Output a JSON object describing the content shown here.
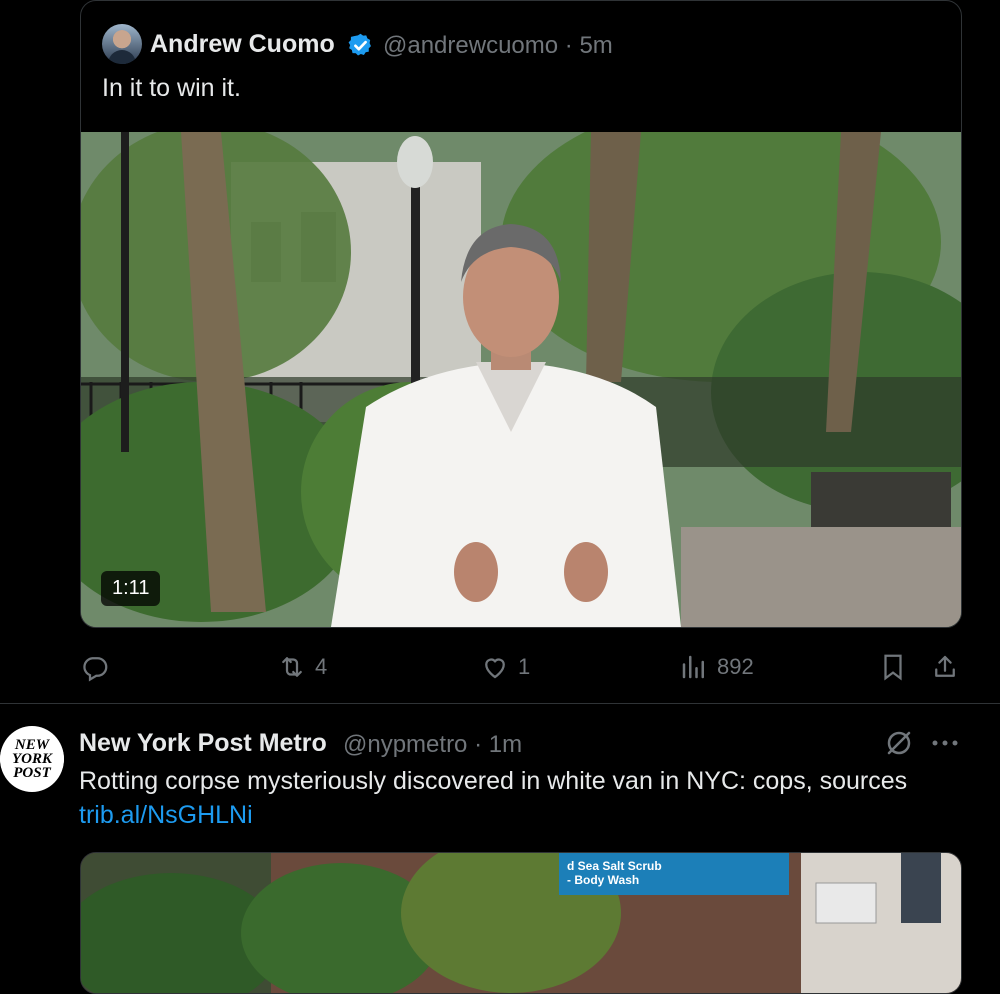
{
  "quoted_tweet": {
    "author_name": "Andrew Cuomo",
    "handle_time": "@andrewcuomo · 5m",
    "text": "In it to win it.",
    "video_duration": "1:11"
  },
  "actions": {
    "reply_count": "",
    "retweet_count": "4",
    "like_count": "1",
    "views_count": "892"
  },
  "post": {
    "author_name": "New York Post Metro",
    "handle_time": "@nypmetro · 1m",
    "text": "Rotting corpse mysteriously discovered in white van in NYC: cops, sources",
    "link": "trib.al/NsGHLNi",
    "avatar_logo_text": "NEW YORK POST",
    "media_sign_text": "d Sea Salt Scrub\n- Body Wash"
  },
  "colors": {
    "background": "#000000",
    "text": "#e7e9ea",
    "muted": "#71767b",
    "link": "#1d9bf0",
    "verified": "#1d9bf0"
  },
  "icons": [
    "avatar",
    "verified-icon",
    "reply-icon",
    "retweet-icon",
    "like-icon",
    "views-icon",
    "bookmark-icon",
    "share-icon",
    "grok-icon",
    "more-icon"
  ]
}
